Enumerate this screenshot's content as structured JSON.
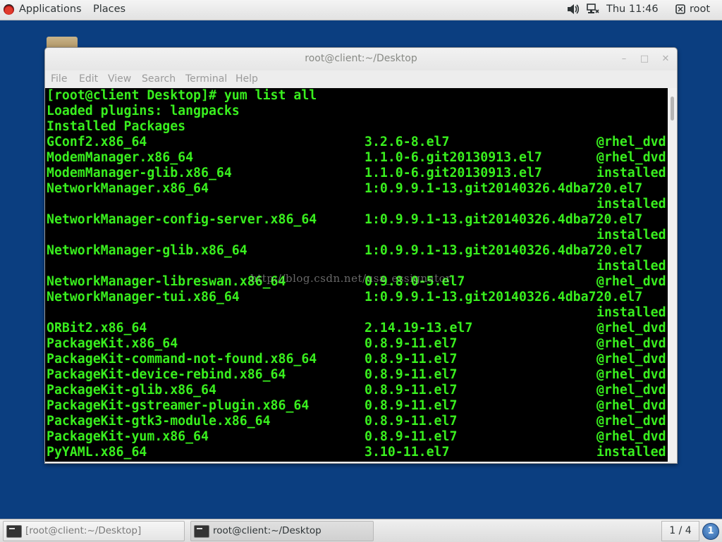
{
  "top_bar": {
    "applications_label": "Applications",
    "places_label": "Places",
    "clock": "Thu 11:46",
    "user_label": "root"
  },
  "window": {
    "title": "root@client:~/Desktop",
    "menu": [
      "File",
      "Edit",
      "View",
      "Search",
      "Terminal",
      "Help"
    ]
  },
  "terminal": {
    "lines": [
      {
        "full": "[root@client Desktop]# yum list all"
      },
      {
        "full": "Loaded plugins: langpacks"
      },
      {
        "full": "Installed Packages"
      },
      {
        "pkg": "GConf2.x86_64",
        "ver": "3.2.6-8.el7",
        "repo": "@rhel_dvd"
      },
      {
        "pkg": "ModemManager.x86_64",
        "ver": "1.1.0-6.git20130913.el7",
        "repo": "@rhel_dvd"
      },
      {
        "pkg": "ModemManager-glib.x86_64",
        "ver": "1.1.0-6.git20130913.el7",
        "repo": "installed"
      },
      {
        "pkg": "NetworkManager.x86_64",
        "ver": "1:0.9.9.1-13.git20140326.4dba720.el7",
        "repo": ""
      },
      {
        "pkg": "",
        "ver": "",
        "repo": "installed"
      },
      {
        "pkg": "NetworkManager-config-server.x86_64",
        "ver": "1:0.9.9.1-13.git20140326.4dba720.el7",
        "repo": ""
      },
      {
        "pkg": "",
        "ver": "",
        "repo": "installed"
      },
      {
        "pkg": "NetworkManager-glib.x86_64",
        "ver": "1:0.9.9.1-13.git20140326.4dba720.el7",
        "repo": ""
      },
      {
        "pkg": "",
        "ver": "",
        "repo": "installed"
      },
      {
        "pkg": "NetworkManager-libreswan.x86_64",
        "ver": "0.9.8.0-5.el7",
        "repo": "@rhel_dvd"
      },
      {
        "pkg": "NetworkManager-tui.x86_64",
        "ver": "1:0.9.9.1-13.git20140326.4dba720.el7",
        "repo": ""
      },
      {
        "pkg": "",
        "ver": "",
        "repo": "installed"
      },
      {
        "pkg": "ORBit2.x86_64",
        "ver": "2.14.19-13.el7",
        "repo": "@rhel_dvd"
      },
      {
        "pkg": "PackageKit.x86_64",
        "ver": "0.8.9-11.el7",
        "repo": "@rhel_dvd"
      },
      {
        "pkg": "PackageKit-command-not-found.x86_64",
        "ver": "0.8.9-11.el7",
        "repo": "@rhel_dvd"
      },
      {
        "pkg": "PackageKit-device-rebind.x86_64",
        "ver": "0.8.9-11.el7",
        "repo": "@rhel_dvd"
      },
      {
        "pkg": "PackageKit-glib.x86_64",
        "ver": "0.8.9-11.el7",
        "repo": "@rhel_dvd"
      },
      {
        "pkg": "PackageKit-gstreamer-plugin.x86_64",
        "ver": "0.8.9-11.el7",
        "repo": "@rhel_dvd"
      },
      {
        "pkg": "PackageKit-gtk3-module.x86_64",
        "ver": "0.8.9-11.el7",
        "repo": "@rhel_dvd"
      },
      {
        "pkg": "PackageKit-yum.x86_64",
        "ver": "0.8.9-11.el7",
        "repo": "@rhel_dvd"
      },
      {
        "pkg": "PyYAML.x86_64",
        "ver": "3.10-11.el7",
        "repo": "installed"
      }
    ]
  },
  "watermark": "http://blog.csdn.net/usa_essignator",
  "taskbar": {
    "tasks": [
      {
        "label": "[root@client:~/Desktop]"
      },
      {
        "label": "root@client:~/Desktop"
      }
    ],
    "workspace": "1 / 4",
    "notification_count": "1"
  },
  "colors": {
    "desktop_background": "#0b3e80",
    "terminal_background": "#000000",
    "terminal_text": "#39ef1e"
  },
  "icons": [
    "red-hat-logo-icon",
    "volume-icon",
    "network-icon",
    "user-icon",
    "folder-icon",
    "terminal-icon",
    "notification-icon"
  ]
}
